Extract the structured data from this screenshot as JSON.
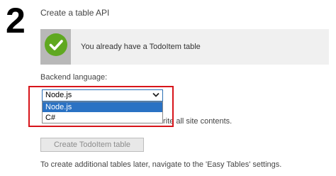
{
  "step": {
    "number": "2",
    "title": "Create a table API"
  },
  "status": {
    "message": "You already have a TodoItem table",
    "icon": "checkmark-icon",
    "color": "#5fa820"
  },
  "backend": {
    "label": "Backend language:",
    "selected": "Node.js",
    "options": [
      "Node.js",
      "C#"
    ]
  },
  "overwrite_text": "rite all site contents.",
  "create_button": {
    "label": "Create TodoItem table"
  },
  "footer": "To create additional tables later, navigate to the 'Easy Tables' settings.",
  "colors": {
    "accent": "#2a72c4",
    "highlight": "#d7141a"
  }
}
